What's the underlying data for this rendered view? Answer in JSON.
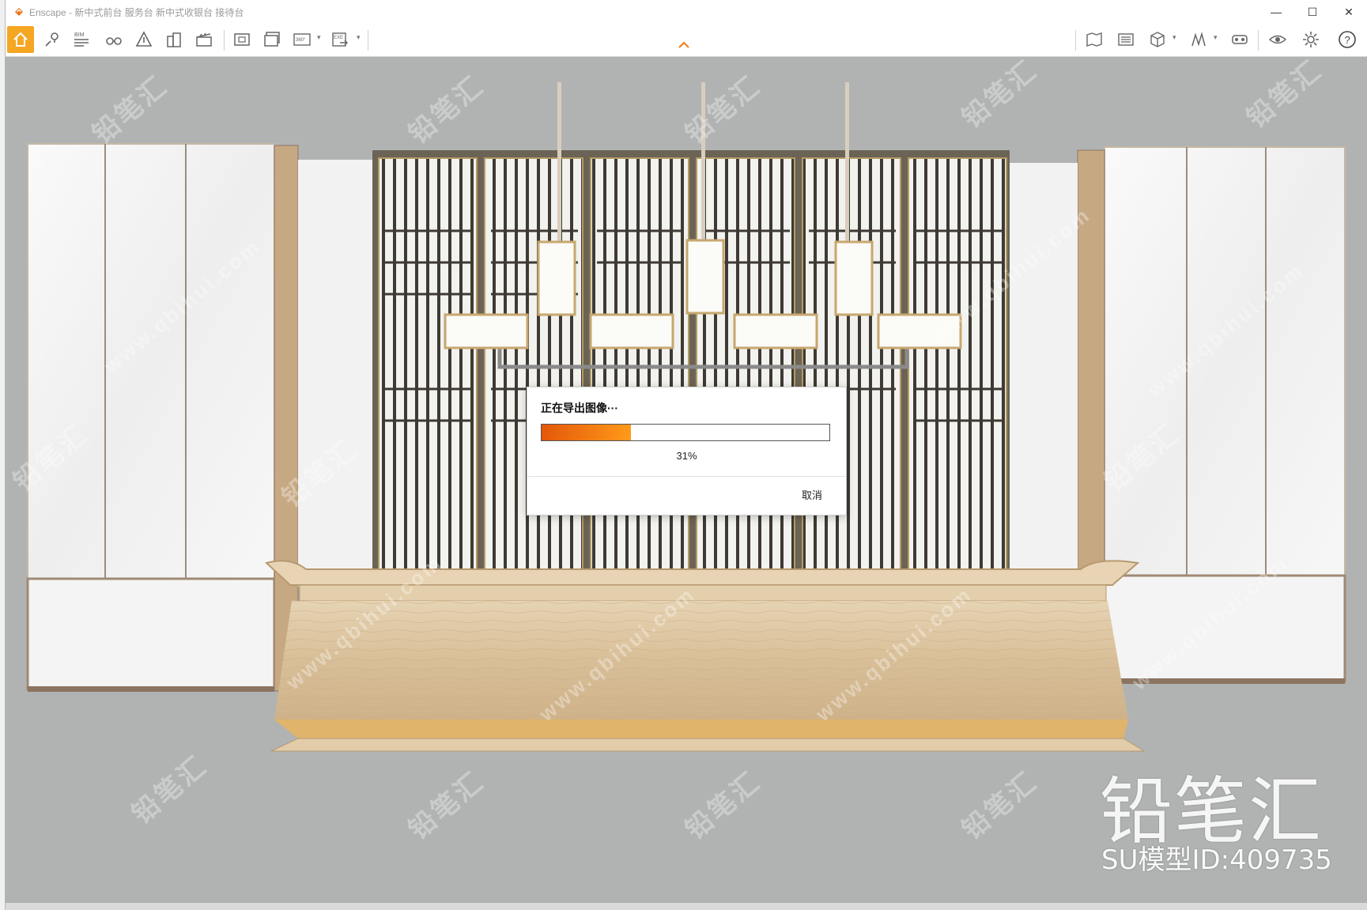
{
  "window": {
    "app_name": "Enscape",
    "title": "Enscape - 新中式前台 服务台 新中式收银台 接待台",
    "controls": {
      "minimize": "—",
      "maximize": "☐",
      "close": "✕"
    }
  },
  "toolbar": {
    "left_buttons": [
      {
        "name": "home-icon"
      },
      {
        "name": "map-pin-icon"
      },
      {
        "name": "bim-icon",
        "label": "BIM"
      },
      {
        "name": "binoculars-icon"
      },
      {
        "name": "atmosphere-icon"
      },
      {
        "name": "buildings-icon"
      },
      {
        "name": "clapperboard-icon"
      },
      {
        "name": "screenshot-icon"
      },
      {
        "name": "batch-render-icon"
      },
      {
        "name": "panorama-icon",
        "label": "360°"
      },
      {
        "name": "export-exe-icon",
        "label": "EXE"
      }
    ],
    "right_buttons": [
      {
        "name": "material-editor-icon"
      },
      {
        "name": "visual-settings-icon"
      },
      {
        "name": "asset-library-icon"
      },
      {
        "name": "sketch-icon"
      },
      {
        "name": "vr-headset-icon"
      },
      {
        "name": "eye-icon"
      },
      {
        "name": "settings-gear-icon"
      },
      {
        "name": "help-icon",
        "label": "?"
      }
    ],
    "accent_color": "#f5a623"
  },
  "dialog": {
    "title": "正在导出图像···",
    "progress": 0.31,
    "progress_label": "31%",
    "cancel_label": "取消"
  },
  "watermark": {
    "brand": "铅笔汇",
    "url": "www.qbihui.com",
    "model_id": "SU模型ID:409735"
  },
  "colors": {
    "viewport_bg": "#b1b3b3",
    "progress_start": "#e4570a",
    "progress_end": "#ff9a1a"
  }
}
